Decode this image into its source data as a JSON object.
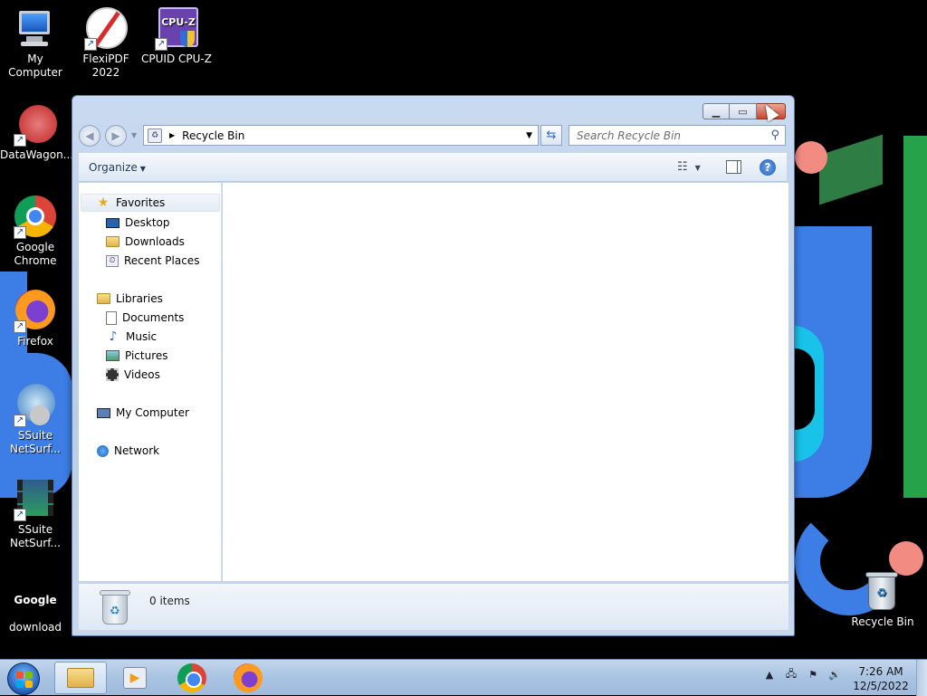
{
  "desktop": {
    "icons": [
      {
        "label": "My Computer",
        "icon": "my-computer-icon"
      },
      {
        "label": "FlexiPDF 2022",
        "icon": "flexipdf-icon"
      },
      {
        "label": "CPUID CPU-Z",
        "icon": "cpuz-icon"
      },
      {
        "label": "DataWagon...",
        "icon": "datawagon-icon"
      },
      {
        "label": "Google Chrome",
        "icon": "chrome-icon"
      },
      {
        "label": "Firefox",
        "icon": "firefox-icon"
      },
      {
        "label": "SSuite NetSurf...",
        "icon": "ssuite-netsurfer-icon"
      },
      {
        "label": "SSuite NetSurf...",
        "icon": "ssuite-netsurfer-video-icon"
      },
      {
        "label": "download",
        "icon": "google-download-icon"
      },
      {
        "label": "Recycle Bin",
        "icon": "recycle-bin-icon"
      }
    ],
    "cpuz_badge": "CPU-Z",
    "google_badge": "Google"
  },
  "window": {
    "address": {
      "path": "Recycle Bin"
    },
    "search": {
      "placeholder": "Search Recycle Bin"
    },
    "command_bar": {
      "organize": "Organize"
    },
    "nav_pane": {
      "favorites": {
        "label": "Favorites",
        "items": [
          "Desktop",
          "Downloads",
          "Recent Places"
        ]
      },
      "libraries": {
        "label": "Libraries",
        "items": [
          "Documents",
          "Music",
          "Pictures",
          "Videos"
        ]
      },
      "computer": "My Computer",
      "network": "Network"
    },
    "details": {
      "item_count": "0 items"
    }
  },
  "taskbar": {
    "pinned": [
      "windows-explorer",
      "media-player",
      "google-chrome",
      "firefox"
    ],
    "clock": {
      "time": "7:26 AM",
      "date": "12/5/2022"
    }
  },
  "colors": {
    "accent": "#3d7ee6",
    "close_button": "#c9462c"
  }
}
